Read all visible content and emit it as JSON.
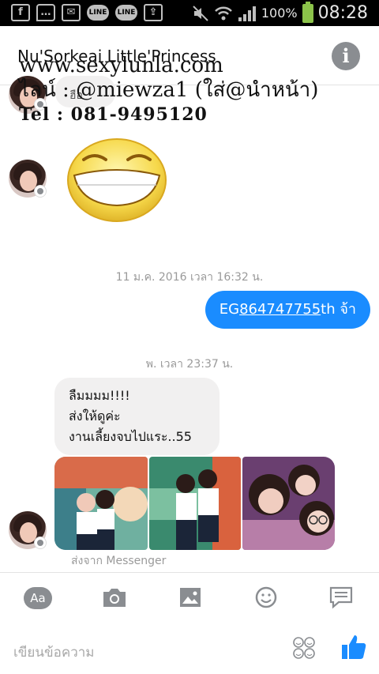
{
  "status_bar": {
    "notif_icons": [
      "facebook-icon",
      "chat-icon",
      "mail-icon",
      "line-icon",
      "line-icon",
      "bag-icon"
    ],
    "line_label": "LINE",
    "battery_pct": "100%",
    "time": "08:28"
  },
  "header": {
    "title": "Nu'Sorkeai Little'Princess",
    "info_label": "i"
  },
  "watermark": {
    "line1": "www.sexylunla.com",
    "line2": "ไลน์ : @miewza1 (ใส่@นำหน้า)",
    "line3": "Tel : 081-9495120"
  },
  "chat": {
    "partial_bubble": "ฮือ",
    "timestamp1": "11 ม.ค. 2016 เวลา 16:32 น.",
    "outgoing": {
      "prefix": "EG",
      "link": "864747755",
      "suffix": "th จ้า"
    },
    "timestamp2": "พ. เวลา 23:37 น.",
    "incoming_lines": [
      "ลืมมมม!!!!",
      "ส่งให้ดูค่ะ",
      "งานเลี้ยงจบไปแระ..55"
    ],
    "sent_from": "ส่งจาก Messenger"
  },
  "composer": {
    "aa_label": "Aa",
    "placeholder": "เขียนข้อความ"
  },
  "colors": {
    "accent": "#1a8cff",
    "bubble_in": "#f1f0f0",
    "icon_gray": "#8a8d91"
  }
}
